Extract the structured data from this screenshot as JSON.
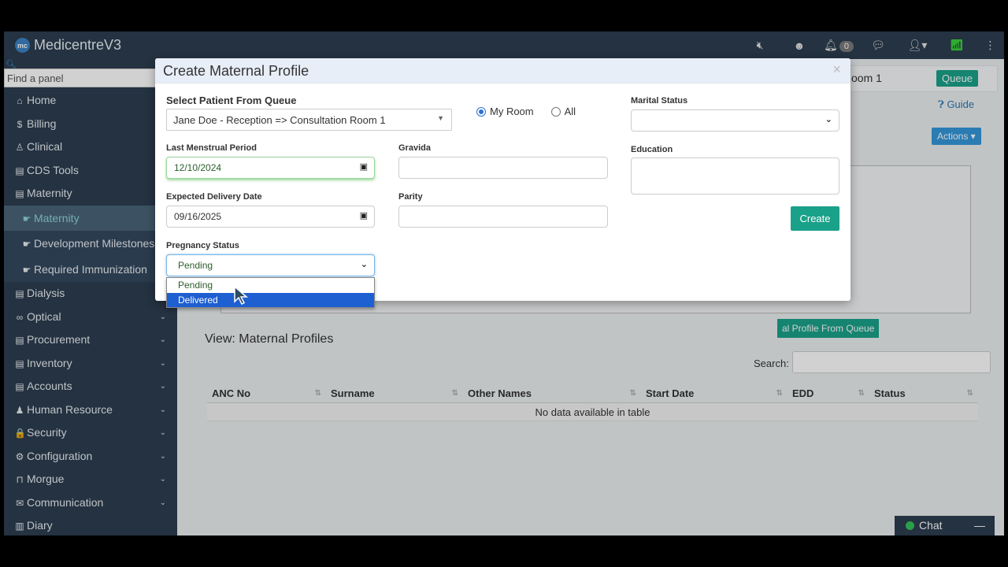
{
  "app": {
    "name": "MedicentreV3",
    "logo_text": "mc"
  },
  "topbar": {
    "notification_count": "0"
  },
  "sidebar": {
    "find_placeholder": "Find a panel",
    "items": [
      {
        "label": "Home",
        "icon": "home-icon",
        "glyph": "⌂"
      },
      {
        "label": "Billing",
        "icon": "dollar-icon",
        "glyph": "$"
      },
      {
        "label": "Clinical",
        "icon": "user-md-icon",
        "glyph": "♙"
      },
      {
        "label": "CDS Tools",
        "icon": "book-icon",
        "glyph": "▤"
      },
      {
        "label": "Maternity",
        "icon": "book-icon",
        "glyph": "▤"
      },
      {
        "label": "Maternity",
        "icon": "hand-point-icon",
        "glyph": "☛"
      },
      {
        "label": "Development Milestones",
        "icon": "hand-point-icon",
        "glyph": "☛"
      },
      {
        "label": "Required Immunization",
        "icon": "hand-point-icon",
        "glyph": "☛"
      },
      {
        "label": "Dialysis",
        "icon": "book-icon",
        "glyph": "▤"
      },
      {
        "label": "Optical",
        "icon": "glasses-icon",
        "glyph": "∞"
      },
      {
        "label": "Procurement",
        "icon": "book-icon",
        "glyph": "▤"
      },
      {
        "label": "Inventory",
        "icon": "book-icon",
        "glyph": "▤"
      },
      {
        "label": "Accounts",
        "icon": "book-icon",
        "glyph": "▤"
      },
      {
        "label": "Human Resource",
        "icon": "users-icon",
        "glyph": "♟"
      },
      {
        "label": "Security",
        "icon": "lock-icon",
        "glyph": "🔒"
      },
      {
        "label": "Configuration",
        "icon": "cogs-icon",
        "glyph": "⚙"
      },
      {
        "label": "Morgue",
        "icon": "bed-icon",
        "glyph": "⊓"
      },
      {
        "label": "Communication",
        "icon": "comments-icon",
        "glyph": "✉"
      },
      {
        "label": "Diary",
        "icon": "book-open-icon",
        "glyph": "▥"
      }
    ]
  },
  "background": {
    "room_title": "oom 1",
    "queue_label": "Queue",
    "guide_label": "Guide",
    "actions_label": "Actions ▾",
    "create_from_queue_label": "al Profile From Queue",
    "view_title": "View: Maternal Profiles",
    "search_label": "Search:",
    "table": {
      "columns": [
        "ANC No",
        "Surname",
        "Other Names",
        "Start Date",
        "EDD",
        "Status"
      ],
      "empty_text": "No data available in table"
    }
  },
  "modal": {
    "title": "Create Maternal Profile",
    "close_glyph": "×",
    "select_patient_label": "Select Patient From Queue",
    "select_patient_value": "Jane Doe - Reception => Consultation Room 1",
    "radio_my_room": "My Room",
    "radio_all": "All",
    "marital_status_label": "Marital Status",
    "marital_status_value": "",
    "lmp_label": "Last Menstrual Period",
    "lmp_value": "12/10/2024",
    "gravida_label": "Gravida",
    "gravida_value": "",
    "education_label": "Education",
    "education_value": "",
    "edd_label": "Expected Delivery Date",
    "edd_value": "09/16/2025",
    "parity_label": "Parity",
    "parity_value": "",
    "create_label": "Create",
    "pregnancy_status_label": "Pregnancy Status",
    "pregnancy_status_value": "Pending",
    "pregnancy_status_options": [
      "Pending",
      "Delivered"
    ],
    "highlighted_option": "Delivered"
  },
  "chat": {
    "label": "Chat",
    "minimize": "—"
  },
  "colors": {
    "primary_teal": "#1aa189",
    "navbar": "#2c3e50",
    "selected_option": "#1e5fd1"
  }
}
